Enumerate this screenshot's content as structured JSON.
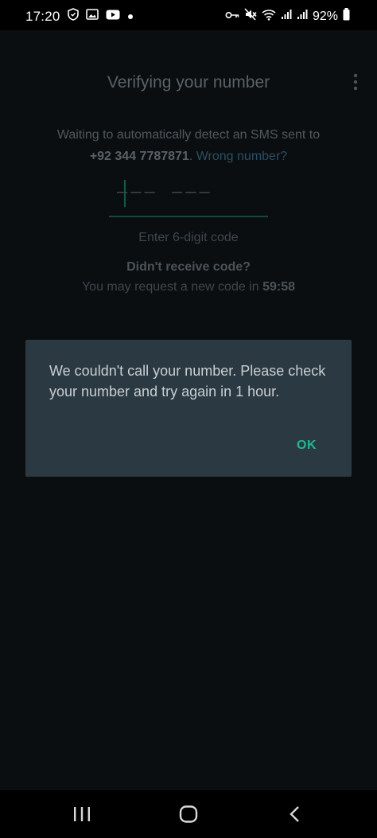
{
  "status_bar": {
    "time": "17:20",
    "battery": "92%",
    "icons": [
      "shield-icon",
      "image-icon",
      "youtube-icon",
      "dot-icon",
      "key-icon",
      "mute-icon",
      "wifi-icon",
      "signal-icon",
      "signal-icon",
      "battery-icon"
    ]
  },
  "header": {
    "title": "Verifying your number"
  },
  "verification": {
    "info_text": "Waiting to automatically detect an SMS sent to",
    "phone_number": "+92 344 7787871",
    "period": ".",
    "wrong_number_link": "Wrong number?",
    "code_placeholder": "––– –––",
    "code_hint": "Enter 6-digit code",
    "didnt_receive": "Didn't receive code?",
    "request_prefix": "You may request a new code in",
    "timer": "59:58"
  },
  "dialog": {
    "message": "We couldn't call your number. Please check your number and try again in 1 hour.",
    "ok_label": "OK"
  },
  "colors": {
    "accent": "#1fb893",
    "dialog_bg": "#2b3a42",
    "link": "#2a4f63"
  }
}
